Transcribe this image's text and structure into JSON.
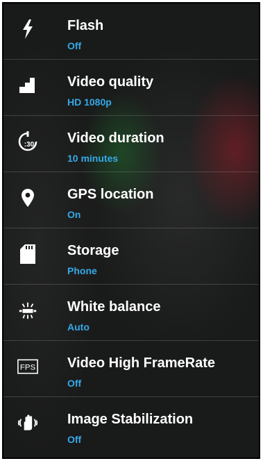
{
  "settings": [
    {
      "title": "Flash",
      "value": "Off",
      "icon": "flash-icon"
    },
    {
      "title": "Video quality",
      "value": "HD 1080p",
      "icon": "video-quality-icon"
    },
    {
      "title": "Video duration",
      "value": "10 minutes",
      "icon": "timer-icon"
    },
    {
      "title": "GPS location",
      "value": "On",
      "icon": "location-pin-icon"
    },
    {
      "title": "Storage",
      "value": "Phone",
      "icon": "sd-card-icon"
    },
    {
      "title": "White balance",
      "value": "Auto",
      "icon": "white-balance-icon"
    },
    {
      "title": "Video High FrameRate",
      "value": "Off",
      "icon": "fps-icon",
      "icon_text": "FPS"
    },
    {
      "title": "Image Stabilization",
      "value": "Off",
      "icon": "stabilization-hand-icon"
    }
  ],
  "duration_icon_text": ":30",
  "colors": {
    "background": "#191a1a",
    "title": "#ffffff",
    "value": "#35a9e8",
    "divider": "rgba(255,255,255,0.16)"
  }
}
